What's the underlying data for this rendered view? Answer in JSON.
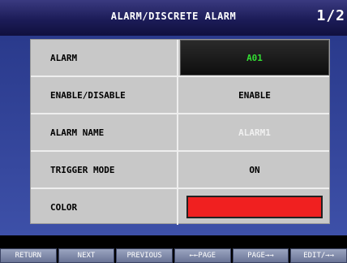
{
  "header": {
    "title": "ALARM/DISCRETE ALARM",
    "page": "1/2"
  },
  "rows": [
    {
      "label": "ALARM",
      "value": "A01"
    },
    {
      "label": "ENABLE/DISABLE",
      "value": "ENABLE"
    },
    {
      "label": "ALARM NAME",
      "value": "ALARM1"
    },
    {
      "label": "TRIGGER MODE",
      "value": "ON"
    },
    {
      "label": "COLOR",
      "value_color": "#f02020"
    }
  ],
  "toolbar": {
    "return": "RETURN",
    "next": "NEXT",
    "previous": "PREVIOUS",
    "page_prev": "←←PAGE",
    "page_next": "PAGE→→",
    "edit": "EDIT/→→"
  }
}
